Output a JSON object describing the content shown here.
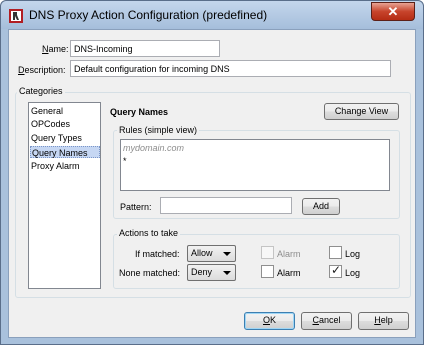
{
  "window": {
    "title": "DNS Proxy Action Configuration (predefined)",
    "close_glyph": "✕"
  },
  "form": {
    "name_label": "Name:",
    "name_value": "DNS-Incoming",
    "description_label": "Description:",
    "description_value": "Default configuration for incoming DNS"
  },
  "categories": {
    "title": "Categories",
    "items": [
      "General",
      "OPCodes",
      "Query Types",
      "Query Names",
      "Proxy Alarm"
    ],
    "selected": "Query Names"
  },
  "panel": {
    "heading": "Query Names",
    "change_view_label": "Change View"
  },
  "rules": {
    "title": "Rules (simple view)",
    "items": [
      "mydomain.com",
      "*"
    ],
    "pattern_label": "Pattern:",
    "pattern_value": "",
    "add_label": "Add"
  },
  "actions": {
    "title": "Actions to take",
    "if_matched_label": "If matched:",
    "if_matched_value": "Allow",
    "if_matched_alarm_label": "Alarm",
    "if_matched_alarm_checked": false,
    "if_matched_alarm_enabled": false,
    "if_matched_log_label": "Log",
    "if_matched_log_checked": false,
    "none_matched_label": "None matched:",
    "none_matched_value": "Deny",
    "none_matched_alarm_label": "Alarm",
    "none_matched_alarm_checked": false,
    "none_matched_log_label": "Log",
    "none_matched_log_checked": true,
    "check_glyph": "✓"
  },
  "buttons": {
    "ok": "OK",
    "cancel": "Cancel",
    "help": "Help"
  },
  "colors": {
    "title_bar": "#a9c1dc",
    "close_button": "#c7442c",
    "selected_item": "#c6d7f3"
  }
}
